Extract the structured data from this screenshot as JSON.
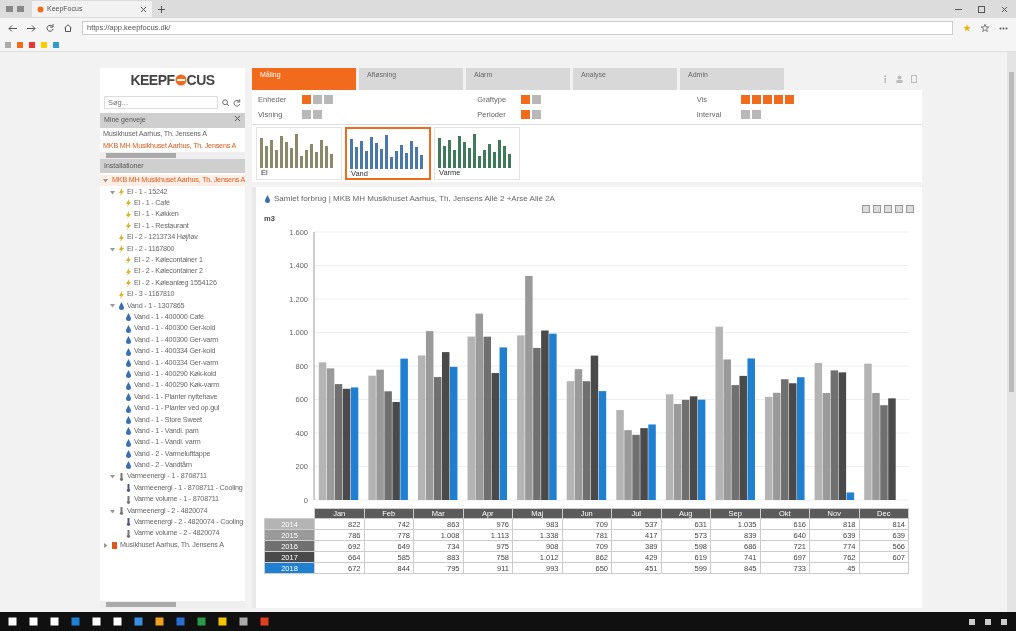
{
  "browser": {
    "tab_title": "KeepFocus",
    "url": "https://app.keepfocus.dk/"
  },
  "app": {
    "logo_left": "KEEPF",
    "logo_right": "CUS",
    "tabs": [
      {
        "label": "Måling",
        "selected": true
      },
      {
        "label": "Afløsning",
        "selected": false
      },
      {
        "label": "Alarm",
        "selected": false
      },
      {
        "label": "Analyse",
        "selected": false
      },
      {
        "label": "Admin",
        "selected": false
      }
    ],
    "sidebar": {
      "search": {
        "placeholder": "Søg..."
      },
      "shortcuts_title": "Mine genveje",
      "shortcuts": [
        {
          "label": "Musikhuset Aarhus, Th. Jensens A",
          "selected": false
        },
        {
          "label": "MKB MH Musikhuset Aarhus, Th. Jensens A",
          "selected": true
        }
      ],
      "installations_title": "Installationer",
      "tree": [
        {
          "label": "MKB MH Musikhuset Aarhus, Th. Jensens A",
          "kind": "site",
          "selected": true,
          "expanded": true,
          "children": [
            {
              "label": "El - 1 - 15242",
              "kind": "el",
              "selected": false,
              "expanded": true,
              "children": [
                {
                  "label": "El - 1 - Café",
                  "kind": "el",
                  "selected": false
                },
                {
                  "label": "El - 1 - Køkken",
                  "kind": "el",
                  "selected": false
                },
                {
                  "label": "El - 1 - Restaurant",
                  "kind": "el",
                  "selected": false
                }
              ]
            },
            {
              "label": "El - 2 - 1213734 Høj/lav",
              "kind": "el",
              "selected": false
            },
            {
              "label": "El - 2 - 1167800",
              "kind": "el",
              "selected": false,
              "expanded": true,
              "children": [
                {
                  "label": "El - 2 - Kølecontainer 1",
                  "kind": "el",
                  "selected": false
                },
                {
                  "label": "El - 2 - Kølecontainer 2",
                  "kind": "el",
                  "selected": false
                },
                {
                  "label": "El - 2 - Køleanlæg 1554126",
                  "kind": "el",
                  "selected": false
                }
              ]
            },
            {
              "label": "El - 3 - 1167810",
              "kind": "el",
              "selected": false
            },
            {
              "label": "Vand - 1 - 1307865",
              "kind": "vand",
              "selected": false,
              "expanded": true,
              "children": [
                {
                  "label": "Vand - 1 - 400000 Café",
                  "kind": "vand",
                  "selected": false
                },
                {
                  "label": "Vand - 1 - 400300 Ger-kold",
                  "kind": "vand",
                  "selected": false
                },
                {
                  "label": "Vand - 1 - 400300 Ger-varm",
                  "kind": "vand",
                  "selected": false
                },
                {
                  "label": "Vand - 1 - 400334 Ger-kold",
                  "kind": "vand",
                  "selected": false
                },
                {
                  "label": "Vand - 1 - 400334 Ger-varm",
                  "kind": "vand",
                  "selected": false
                },
                {
                  "label": "Vand - 1 - 400290 Køk-kold",
                  "kind": "vand",
                  "selected": false
                },
                {
                  "label": "Vand - 1 - 400290 Køk-varm",
                  "kind": "vand",
                  "selected": false
                },
                {
                  "label": "Vand - 1 - Planter nyttehave",
                  "kind": "vand",
                  "selected": false
                },
                {
                  "label": "Vand - 1 - Planter ved op.gul",
                  "kind": "vand",
                  "selected": false
                },
                {
                  "label": "Vand - 1 - Store Sweet",
                  "kind": "vand",
                  "selected": false
                },
                {
                  "label": "Vand - 1 - Vandi. pam",
                  "kind": "vand",
                  "selected": false
                },
                {
                  "label": "Vand - 1 - Vandi. varm",
                  "kind": "vand",
                  "selected": false
                },
                {
                  "label": "Vand - 2 - Varmelufttappe",
                  "kind": "vand",
                  "selected": false
                },
                {
                  "label": "Vand - 2 - Vandtårn",
                  "kind": "vand",
                  "selected": false
                }
              ]
            },
            {
              "label": "Varmeenergi - 1 - 8708711",
              "kind": "varme",
              "selected": false,
              "expanded": true,
              "children": [
                {
                  "label": "Varmeenergi - 1 - 8708711 - Cooling",
                  "kind": "kulde",
                  "selected": false
                },
                {
                  "label": "Varme volume - 1 - 8708711",
                  "kind": "varme",
                  "selected": false
                }
              ]
            },
            {
              "label": "Varmeenergi - 2 - 4820074",
              "kind": "varme",
              "selected": false,
              "expanded": true,
              "children": [
                {
                  "label": "Varmeenergi - 2 - 4820074 - Cooling",
                  "kind": "kulde",
                  "selected": false
                },
                {
                  "label": "Varme volume - 2 - 4820074",
                  "kind": "varme",
                  "selected": false
                }
              ]
            }
          ]
        },
        {
          "label": "Musikhuset Aarhus, Th. Jensens A",
          "kind": "site",
          "selected": false,
          "expanded": false
        }
      ]
    },
    "controls": [
      {
        "label": "Enheder",
        "options": [
          {
            "selected": true
          },
          {
            "selected": false
          },
          {
            "selected": false
          }
        ]
      },
      {
        "label": "Graftype",
        "options": [
          {
            "selected": true
          },
          {
            "selected": false
          }
        ]
      },
      {
        "label": "Vis",
        "options": [
          {
            "selected": true
          },
          {
            "selected": true
          },
          {
            "selected": true
          },
          {
            "selected": true
          },
          {
            "selected": true
          }
        ]
      },
      {
        "label": "Visning",
        "options": [
          {
            "selected": false
          },
          {
            "selected": false
          }
        ]
      },
      {
        "label": "Perioder",
        "options": [
          {
            "selected": true
          },
          {
            "selected": false
          }
        ]
      },
      {
        "label": "Interval",
        "options": [
          {
            "selected": false
          },
          {
            "selected": false
          }
        ]
      }
    ],
    "thumbnails": [
      {
        "label": "El",
        "selected": false,
        "color": "#8a8a6a"
      },
      {
        "label": "Vand",
        "selected": true,
        "color": "#4a78a8"
      },
      {
        "label": "Varme",
        "selected": false,
        "color": "#3f7a5a"
      }
    ],
    "panel": {
      "title": "Samlet forbrug | MKB MH Musikhuset Aarhus, Th. Jensens Allé 2 +Arse Allé 2A",
      "chart_data": {
        "type": "bar",
        "ylabel": "m3",
        "categories": [
          "Jan",
          "Feb",
          "Mar",
          "Apr",
          "Maj",
          "Jun",
          "Jul",
          "Aug",
          "Sep",
          "Okt",
          "Nov",
          "Dec"
        ],
        "series": [
          {
            "name": "2014",
            "color": "#b4b4b4",
            "values": [
              822,
              742,
              863,
              976,
              983,
              709,
              537,
              631,
              1035,
              616,
              818,
              814
            ]
          },
          {
            "name": "2015",
            "color": "#9a9a9a",
            "values": [
              786,
              778,
              1008,
              1113,
              1338,
              781,
              417,
              573,
              839,
              640,
              639,
              639
            ]
          },
          {
            "name": "2016",
            "color": "#707070",
            "values": [
              692,
              649,
              734,
              975,
              908,
              709,
              389,
              598,
              686,
              721,
              774,
              566
            ]
          },
          {
            "name": "2017",
            "color": "#4a4a4a",
            "values": [
              664,
              585,
              883,
              758,
              1012,
              862,
              429,
              619,
              741,
              697,
              762,
              607
            ]
          },
          {
            "name": "2018",
            "color": "#1f7fd0",
            "values": [
              672,
              844,
              795,
              911,
              993,
              650,
              451,
              599,
              845,
              733,
              45,
              null
            ]
          }
        ],
        "ylim": [
          0,
          1600
        ],
        "grid": true,
        "yticks": [
          {
            "value": 0,
            "label": "0"
          },
          {
            "value": 200,
            "label": "200"
          },
          {
            "value": 400,
            "label": "400"
          },
          {
            "value": 600,
            "label": "600"
          },
          {
            "value": 800,
            "label": "800"
          },
          {
            "value": 1000,
            "label": "1.000"
          },
          {
            "value": 1200,
            "label": "1.200"
          },
          {
            "value": 1400,
            "label": "1.400"
          },
          {
            "value": 1600,
            "label": "1.600"
          }
        ]
      },
      "table_rows": [
        [
          "822",
          "742",
          "863",
          "976",
          "983",
          "709",
          "537",
          "631",
          "1.035",
          "616",
          "818",
          "814"
        ],
        [
          "786",
          "778",
          "1.008",
          "1.113",
          "1.338",
          "781",
          "417",
          "573",
          "839",
          "640",
          "639",
          "639"
        ],
        [
          "692",
          "649",
          "734",
          "975",
          "908",
          "709",
          "389",
          "598",
          "686",
          "721",
          "774",
          "566"
        ],
        [
          "664",
          "585",
          "883",
          "758",
          "1.012",
          "862",
          "429",
          "619",
          "741",
          "697",
          "762",
          "607"
        ],
        [
          "672",
          "844",
          "795",
          "911",
          "993",
          "650",
          "451",
          "599",
          "845",
          "733",
          "45",
          ""
        ]
      ]
    }
  }
}
